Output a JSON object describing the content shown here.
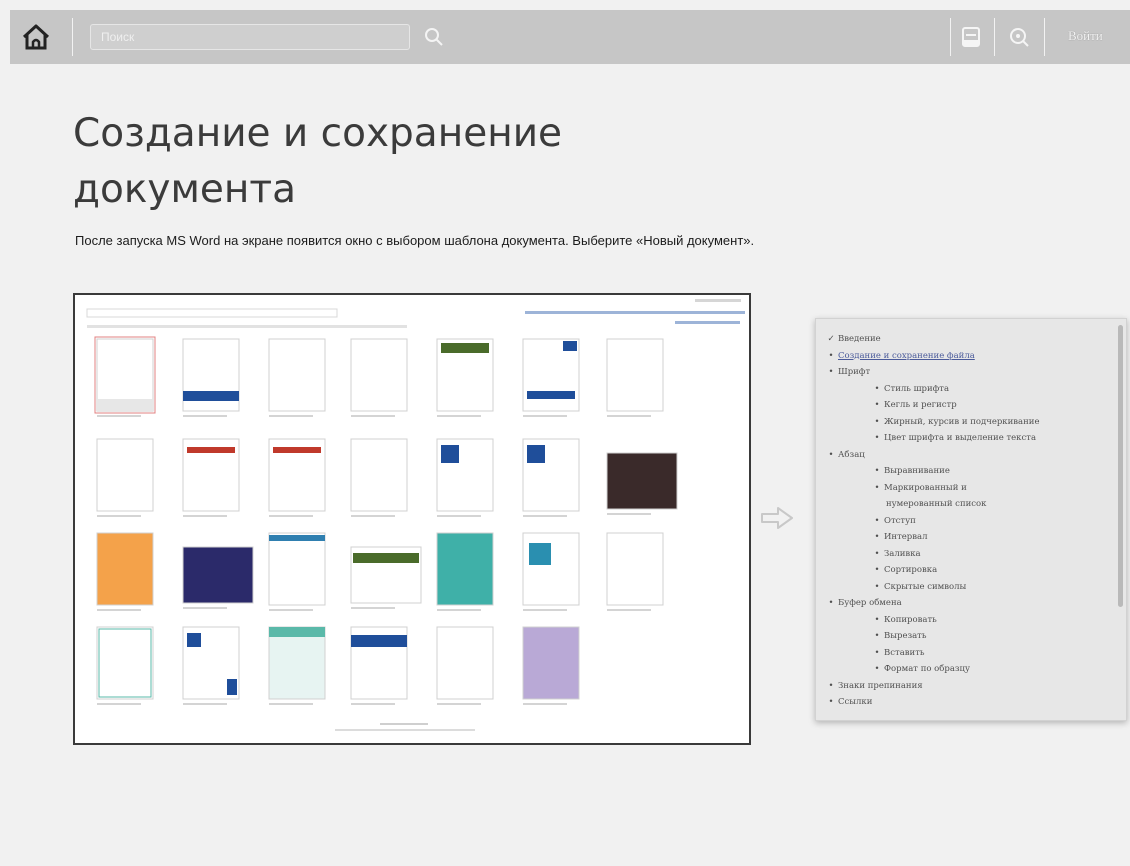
{
  "topbar": {
    "search_placeholder": "Поиск",
    "login_label": "Войти",
    "icons": [
      "home-icon",
      "search-icon",
      "book-icon",
      "zoom-icon"
    ]
  },
  "page": {
    "title": "Создание и сохранение документа",
    "description": "После запуска MS Word на экране появится окно с выбором шаблона документа. Выберите «Новый документ»."
  },
  "toc": {
    "items": [
      {
        "level": 1,
        "bullet": "✓",
        "text": "Введение",
        "link": false
      },
      {
        "level": 1,
        "bullet": "•",
        "text": "Создание и сохранение файла",
        "link": true
      },
      {
        "level": 1,
        "bullet": "•",
        "text": "Шрифт",
        "link": false
      },
      {
        "level": 2,
        "bullet": "•",
        "text": "Стиль шрифта",
        "link": false
      },
      {
        "level": 2,
        "bullet": "•",
        "text": "Кегль и регистр",
        "link": false
      },
      {
        "level": 2,
        "bullet": "•",
        "text": "Жирный, курсив и подчеркивание",
        "link": false
      },
      {
        "level": 2,
        "bullet": "•",
        "text": "Цвет шрифта и выделение текста",
        "link": false
      },
      {
        "level": 1,
        "bullet": "•",
        "text": "Абзац",
        "link": false
      },
      {
        "level": 2,
        "bullet": "•",
        "text": "Выравнивание",
        "link": false
      },
      {
        "level": 2,
        "bullet": "•",
        "text": "Маркированный и",
        "link": false
      },
      {
        "level": 3,
        "bullet": "",
        "text": "нумерованный список",
        "link": false
      },
      {
        "level": 2,
        "bullet": "•",
        "text": "Отступ",
        "link": false
      },
      {
        "level": 2,
        "bullet": "•",
        "text": "Интервал",
        "link": false
      },
      {
        "level": 2,
        "bullet": "•",
        "text": "Заливка",
        "link": false
      },
      {
        "level": 2,
        "bullet": "•",
        "text": "Сортировка",
        "link": false
      },
      {
        "level": 2,
        "bullet": "•",
        "text": "Скрытые символы",
        "link": false
      },
      {
        "level": 1,
        "bullet": "•",
        "text": "Буфер обмена",
        "link": false
      },
      {
        "level": 2,
        "bullet": "•",
        "text": "Копировать",
        "link": false
      },
      {
        "level": 2,
        "bullet": "•",
        "text": "Вырезать",
        "link": false
      },
      {
        "level": 2,
        "bullet": "•",
        "text": "Вставить",
        "link": false
      },
      {
        "level": 2,
        "bullet": "•",
        "text": "Формат по образцу",
        "link": false
      },
      {
        "level": 1,
        "bullet": "•",
        "text": "Знаки препинания",
        "link": false
      },
      {
        "level": 1,
        "bullet": "•",
        "text": "Ссылки",
        "link": false
      }
    ]
  },
  "colors": {
    "topbar": "#c6c6c6",
    "page_bg": "#f1f1f1",
    "accent_blue": "#1f4e9a",
    "accent_red": "#c0392b",
    "accent_green": "#4a6b2a"
  }
}
